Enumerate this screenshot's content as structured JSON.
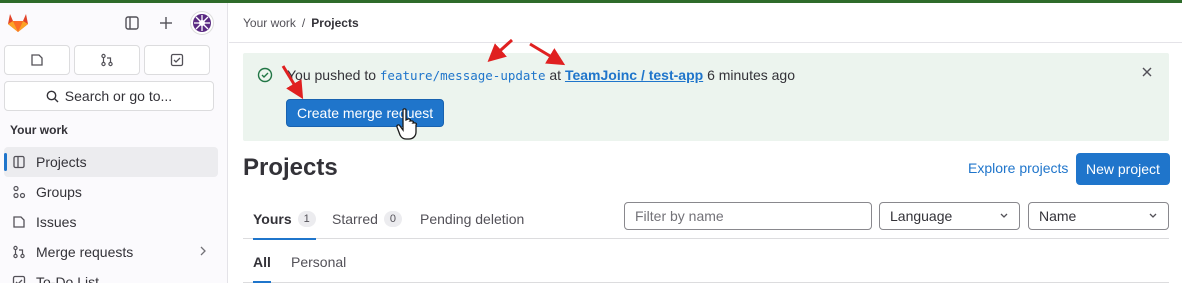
{
  "sidebar": {
    "section_title": "Your work",
    "search_label": "Search or go to...",
    "items": [
      {
        "label": "Projects",
        "icon": "project-icon"
      },
      {
        "label": "Groups",
        "icon": "group-icon"
      },
      {
        "label": "Issues",
        "icon": "issues-icon"
      },
      {
        "label": "Merge requests",
        "icon": "merge-request-icon"
      },
      {
        "label": "To-Do List",
        "icon": "todo-icon"
      }
    ]
  },
  "breadcrumb": {
    "root": "Your work",
    "separator": "/",
    "current": "Projects"
  },
  "alert": {
    "prefix": "You pushed to",
    "branch": "feature/message-update",
    "at": "at",
    "project": "TeamJoinc / test-app",
    "time": "6 minutes ago",
    "button": "Create merge request"
  },
  "page": {
    "title": "Projects",
    "explore_label": "Explore projects",
    "new_project_label": "New project"
  },
  "tabs": [
    {
      "label": "Yours",
      "count": "1"
    },
    {
      "label": "Starred",
      "count": "0"
    },
    {
      "label": "Pending deletion",
      "count": ""
    }
  ],
  "filter": {
    "placeholder": "Filter by name",
    "language_label": "Language",
    "sort_label": "Name"
  },
  "subtabs": [
    "All",
    "Personal"
  ],
  "colors": {
    "accent": "#1f75cb",
    "alert_bg": "#ecf4ee",
    "annotation": "#e02020"
  }
}
